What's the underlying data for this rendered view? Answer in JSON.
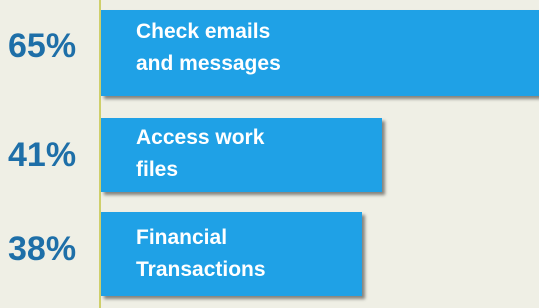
{
  "chart_data": {
    "type": "bar",
    "orientation": "horizontal",
    "categories": [
      "Check emails and messages",
      "Access work files",
      "Financial Transactions"
    ],
    "values": [
      65,
      41,
      38
    ],
    "value_labels": [
      "65%",
      "41%",
      "38%"
    ],
    "bar_label_lines": [
      "Check emails\nand messages",
      "Access work\nfiles",
      "Financial\nTransactions"
    ],
    "xlim": [
      0,
      100
    ],
    "grid": false,
    "legend": "none",
    "colors": {
      "background": "#EFEFE5",
      "bar": "#1FA1E6",
      "value_label": "#1E6FA8",
      "bar_label": "#FFFFFF",
      "axis": "#CFCF6A"
    }
  }
}
